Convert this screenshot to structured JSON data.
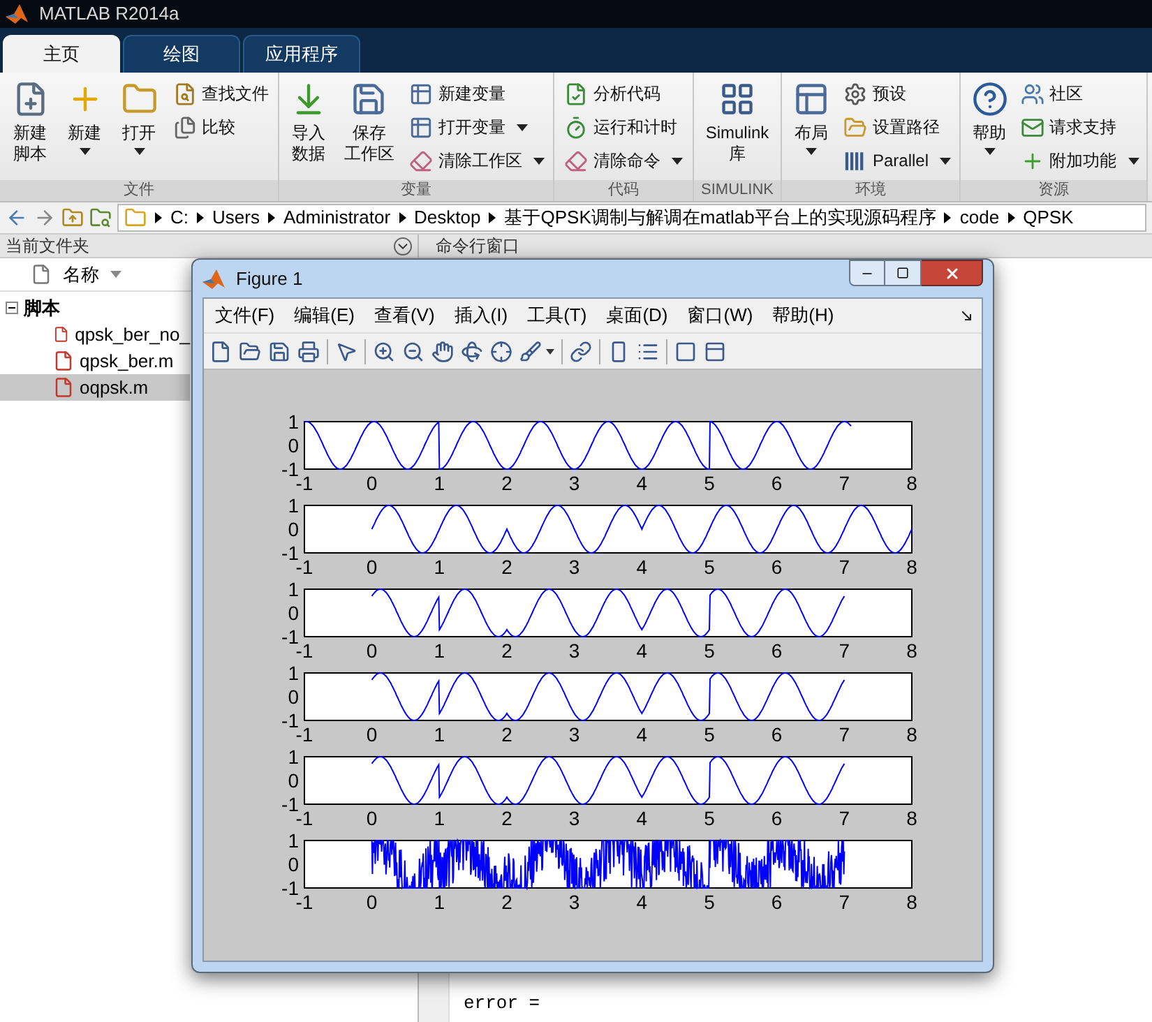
{
  "app_title": "MATLAB R2014a",
  "ribbon_tabs": [
    {
      "label": "主页",
      "selected": true
    },
    {
      "label": "绘图",
      "selected": false
    },
    {
      "label": "应用程序",
      "selected": false
    }
  ],
  "ribbon_sections": [
    {
      "title": "文件",
      "items": [
        {
          "kind": "large",
          "lines": [
            "新建",
            "脚本"
          ],
          "dropdown": false
        },
        {
          "kind": "large",
          "lines": [
            "新建"
          ],
          "dropdown": true
        },
        {
          "kind": "large",
          "lines": [
            "打开"
          ],
          "dropdown": true
        },
        {
          "kind": "small",
          "label": "查找文件",
          "dropdown": false
        },
        {
          "kind": "small",
          "label": "比较",
          "dropdown": false
        }
      ]
    },
    {
      "title": "变量",
      "items": [
        {
          "kind": "large",
          "lines": [
            "导入",
            "数据"
          ],
          "dropdown": false
        },
        {
          "kind": "large",
          "lines": [
            "保存",
            "工作区"
          ],
          "dropdown": false
        },
        {
          "kind": "small",
          "label": "新建变量",
          "dropdown": false
        },
        {
          "kind": "small",
          "label": "打开变量",
          "dropdown": true
        },
        {
          "kind": "small",
          "label": "清除工作区",
          "dropdown": true
        }
      ]
    },
    {
      "title": "代码",
      "items": [
        {
          "kind": "small",
          "label": "分析代码",
          "dropdown": false
        },
        {
          "kind": "small",
          "label": "运行和计时",
          "dropdown": false
        },
        {
          "kind": "small",
          "label": "清除命令",
          "dropdown": true
        }
      ]
    },
    {
      "title": "SIMULINK",
      "items": [
        {
          "kind": "large",
          "lines": [
            "Simulink",
            "库"
          ],
          "dropdown": false
        }
      ]
    },
    {
      "title": "环境",
      "items": [
        {
          "kind": "large",
          "lines": [
            "布局"
          ],
          "dropdown": true
        },
        {
          "kind": "small",
          "label": "预设",
          "dropdown": false
        },
        {
          "kind": "small",
          "label": "设置路径",
          "dropdown": false
        },
        {
          "kind": "small",
          "label": "Parallel",
          "dropdown": true
        }
      ]
    },
    {
      "title": "资源",
      "items": [
        {
          "kind": "large",
          "lines": [
            "帮助"
          ],
          "dropdown": true
        },
        {
          "kind": "small",
          "label": "社区",
          "dropdown": false
        },
        {
          "kind": "small",
          "label": "请求支持",
          "dropdown": false
        },
        {
          "kind": "small",
          "label": "附加功能",
          "dropdown": true
        }
      ]
    }
  ],
  "address_path": [
    "C:",
    "Users",
    "Administrator",
    "Desktop",
    "基于QPSK调制与解调在matlab平台上的实现源码程序",
    "code",
    "QPSK"
  ],
  "current_folder": {
    "title": "当前文件夹",
    "column": "名称",
    "tree": [
      {
        "label": "脚本",
        "expanded": true,
        "children": [
          {
            "label": "qpsk_ber_no_",
            "selected": false
          },
          {
            "label": "qpsk_ber.m",
            "selected": false
          },
          {
            "label": "oqpsk.m",
            "selected": true
          }
        ]
      }
    ]
  },
  "command_window": {
    "title": "命令行窗口",
    "lines": [
      "error ="
    ]
  },
  "figure": {
    "title": "Figure 1",
    "menus": [
      "文件(F)",
      "编辑(E)",
      "查看(V)",
      "插入(I)",
      "工具(T)",
      "桌面(D)",
      "窗口(W)",
      "帮助(H)"
    ],
    "plots": [
      {
        "kind": "wave",
        "xticks": [
          "-1",
          "0",
          "1",
          "2",
          "3",
          "4",
          "5",
          "6",
          "7",
          "8"
        ],
        "yticks": [
          "1",
          "0",
          "-1"
        ]
      },
      {
        "kind": "wave",
        "xticks": [
          "-1",
          "0",
          "1",
          "2",
          "3",
          "4",
          "5",
          "6",
          "7",
          "8"
        ],
        "yticks": [
          "1",
          "0",
          "-1"
        ]
      },
      {
        "kind": "wave",
        "xticks": [
          "-1",
          "0",
          "1",
          "2",
          "3",
          "4",
          "5",
          "6",
          "7",
          "8"
        ],
        "yticks": [
          "1",
          "0",
          "-1"
        ]
      },
      {
        "kind": "wave",
        "xticks": [
          "-1",
          "0",
          "1",
          "2",
          "3",
          "4",
          "5",
          "6",
          "7",
          "8"
        ],
        "yticks": [
          "1",
          "0",
          "-1"
        ]
      },
      {
        "kind": "wave",
        "xticks": [
          "-1",
          "0",
          "1",
          "2",
          "3",
          "4",
          "5",
          "6",
          "7",
          "8"
        ],
        "yticks": [
          "1",
          "0",
          "-1"
        ]
      },
      {
        "kind": "noise",
        "xticks": [
          "-1",
          "0",
          "1",
          "2",
          "3",
          "4",
          "5",
          "6",
          "7",
          "8"
        ],
        "yticks": [
          "1",
          "0",
          "-1"
        ]
      }
    ]
  }
}
